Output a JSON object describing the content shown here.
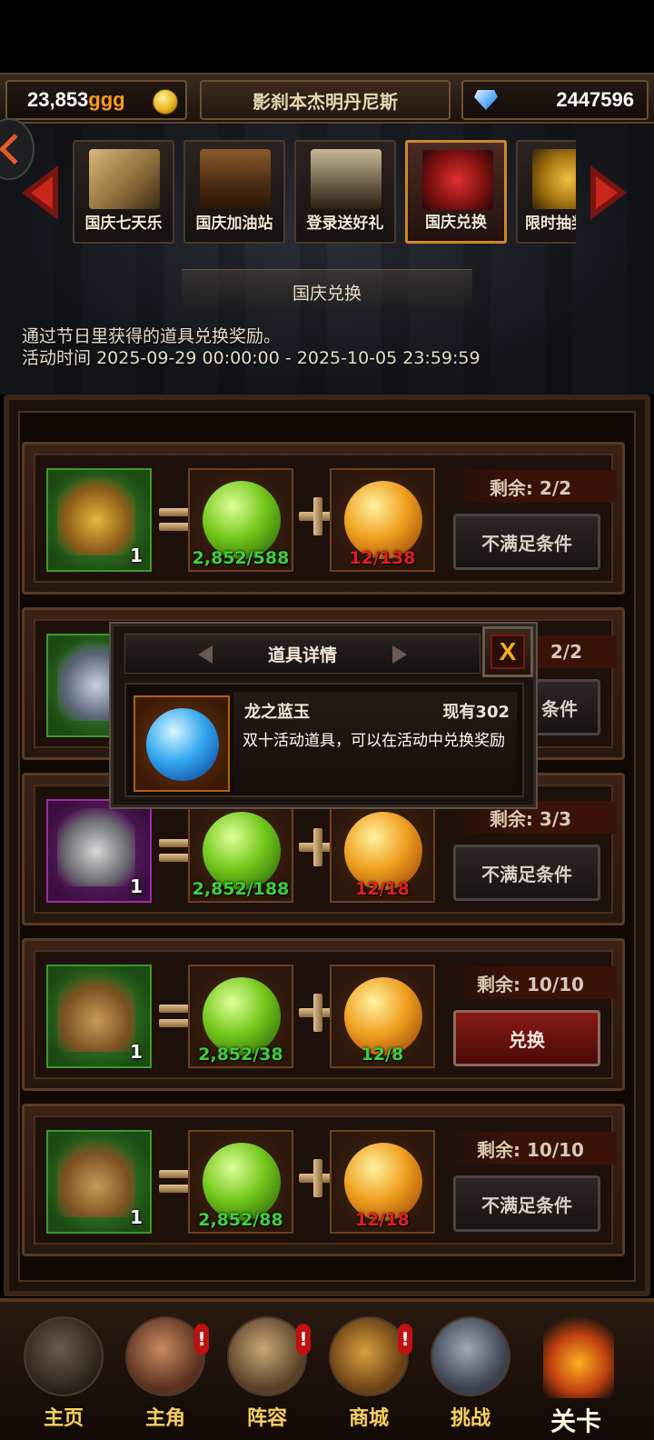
{
  "topbar": {
    "gold_amount": "23,853",
    "gold_unit": "ggg",
    "player_name": "影刹本杰明丹尼斯",
    "gem_amount": "2447596"
  },
  "tabs": [
    {
      "label": "国庆七天乐",
      "icon": "scroll-icon",
      "active": false
    },
    {
      "label": "国庆加油站",
      "icon": "treasure-chest-icon",
      "active": false
    },
    {
      "label": "登录送好礼",
      "icon": "calendar-icon",
      "active": false
    },
    {
      "label": "国庆兑换",
      "icon": "hourglass-icon",
      "active": true
    },
    {
      "label": "限时抽奖",
      "icon": "gold-chest-icon",
      "active": false
    }
  ],
  "activity": {
    "title": "国庆兑换",
    "description": "通过节日里获得的道具兑换奖励。",
    "time_label": "活动时间",
    "time_range": "2025-09-29 00:00:00 - 2025-10-05 23:59:59"
  },
  "exchange_rows": [
    {
      "reward_icon": "golden-dragon-chest-icon",
      "reward_qty": "1",
      "reward_rarity": "green",
      "cost_green": "2,852/588",
      "cost_green_ok": true,
      "cost_orange": "12/138",
      "cost_orange_ok": false,
      "remaining": "剩余: 2/2",
      "action": "不满足条件",
      "action_enabled": false
    },
    {
      "reward_icon": "silver-chest-icon",
      "reward_qty": "1",
      "reward_rarity": "green",
      "cost_green": "",
      "cost_green_ok": true,
      "cost_orange": "",
      "cost_orange_ok": false,
      "remaining": "2/2",
      "action": "条件",
      "action_enabled": false
    },
    {
      "reward_icon": "skull-chest-icon",
      "reward_qty": "1",
      "reward_rarity": "purple",
      "cost_green": "2,852/188",
      "cost_green_ok": true,
      "cost_orange": "12/18",
      "cost_orange_ok": false,
      "remaining": "剩余: 3/3",
      "action": "不满足条件",
      "action_enabled": false
    },
    {
      "reward_icon": "gem-bag-icon",
      "reward_qty": "1",
      "reward_rarity": "green",
      "cost_green": "2,852/38",
      "cost_green_ok": true,
      "cost_orange": "12/8",
      "cost_orange_ok": true,
      "remaining": "剩余: 10/10",
      "action": "兑换",
      "action_enabled": true
    },
    {
      "reward_icon": "gem-bag-icon",
      "reward_qty": "1",
      "reward_rarity": "green",
      "cost_green": "2,852/88",
      "cost_green_ok": true,
      "cost_orange": "12/18",
      "cost_orange_ok": false,
      "remaining": "剩余: 10/10",
      "action": "不满足条件",
      "action_enabled": false
    }
  ],
  "popup": {
    "title": "道具详情",
    "close_label": "X",
    "item_name": "龙之蓝玉",
    "owned": "现有302",
    "description": "双十活动道具，可以在活动中兑换奖励",
    "item_icon": "blue-orb-icon"
  },
  "nav": [
    {
      "label": "主页",
      "icon": "castle-icon",
      "badge": ""
    },
    {
      "label": "主角",
      "icon": "hero-portrait-icon",
      "badge": "!"
    },
    {
      "label": "阵容",
      "icon": "helmet-icon",
      "badge": "!"
    },
    {
      "label": "商城",
      "icon": "shop-chest-icon",
      "badge": "!"
    },
    {
      "label": "挑战",
      "icon": "crossed-axes-icon",
      "badge": ""
    },
    {
      "label": "关卡",
      "icon": "demon-stage-icon",
      "badge": ""
    }
  ],
  "colors": {
    "gold_unit": "#ff9a1a",
    "cost_ok": "#3fd03a",
    "cost_bad": "#e02020",
    "active_tab_border": "#c98a2a",
    "nav_label": "#f8d060"
  }
}
